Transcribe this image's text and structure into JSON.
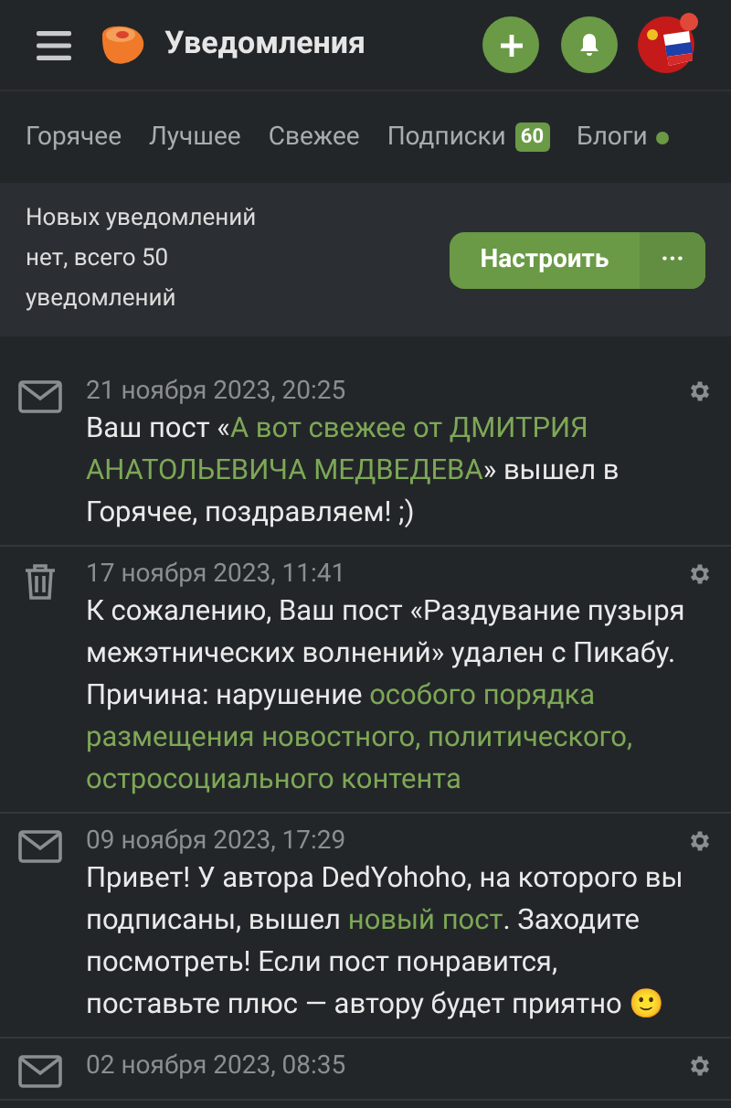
{
  "header": {
    "title": "Уведомления",
    "avatar_has_badge": true
  },
  "tabs": [
    {
      "label": "Горячее"
    },
    {
      "label": "Лучшее"
    },
    {
      "label": "Свежее"
    },
    {
      "label": "Подписки",
      "badge": "60"
    },
    {
      "label": "Блоги",
      "color": "#6a9a45"
    }
  ],
  "summary": {
    "text": "Новых уведомлений нет, всего 50 уведомлений",
    "button": "Настроить",
    "more": "···"
  },
  "notifications": [
    {
      "kind": "mail",
      "date": "21 ноября 2023, 20:25",
      "segments": [
        {
          "text": "Ваш пост «",
          "link": false
        },
        {
          "text": "А вот свежее от ДМИТРИЯ",
          "link": true
        },
        {
          "text": "АНАТОЛЬЕВИЧА МЕДВЕДЕВА",
          "link": true
        },
        {
          "text": "» вышел в Горячее, поздравляем! ;)",
          "link": false
        }
      ]
    },
    {
      "kind": "deleted",
      "date": "17 ноября 2023, 11:41",
      "segments": [
        {
          "text": "К сожалению, Ваш пост «Раздувание пузыря межэтнических волнений» удален с Пикабу. Причина: нарушение ",
          "link": false
        },
        {
          "text": "особого порядка",
          "link": true
        },
        {
          "text": "размещения новостного, политического,",
          "link": true
        },
        {
          "text": "остросоциального контента",
          "link": true
        }
      ]
    },
    {
      "kind": "mail",
      "date": "09 ноября 2023, 17:29",
      "segments": [
        {
          "text": "Привет! У автора DedYohoho, на которого вы подписаны, вышел ",
          "link": false
        },
        {
          "text": "новый пост",
          "link": true
        },
        {
          "text": ". Заходите посмотреть! Если пост понравится, поставьте плюс — автору будет приятно 🙂",
          "link": false
        }
      ]
    },
    {
      "kind": "mail",
      "date": "02 ноября 2023, 08:35"
    }
  ]
}
